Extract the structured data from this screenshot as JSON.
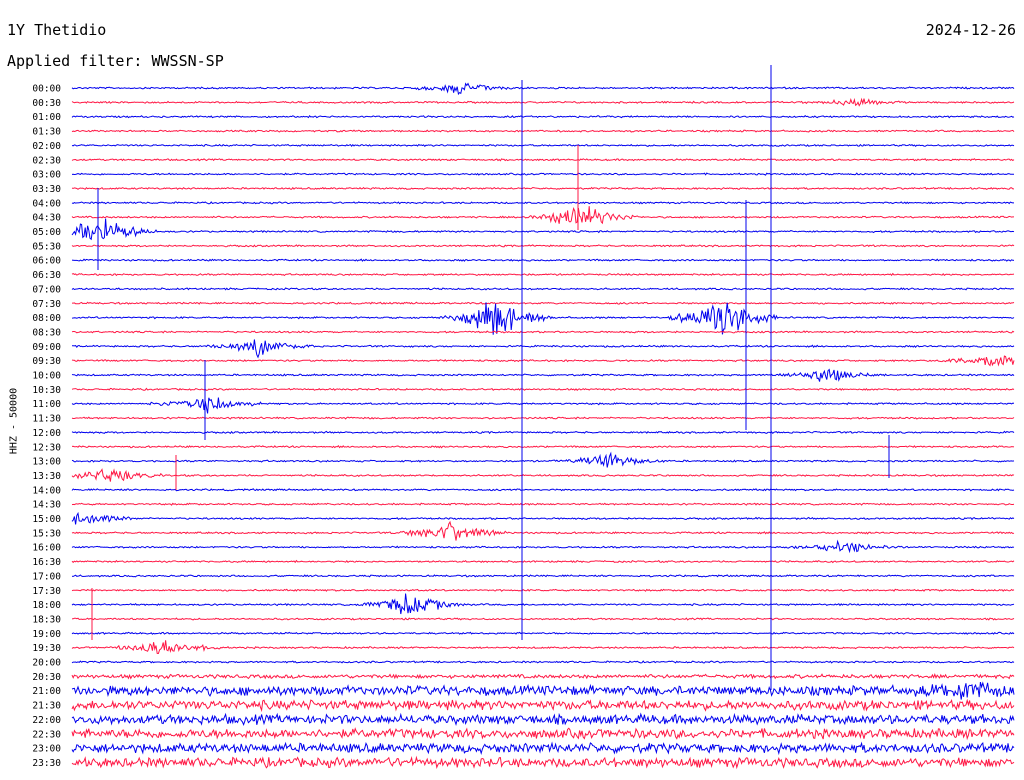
{
  "header": {
    "station": "1Y Thetidio",
    "date": "2024-12-26",
    "filter": "Applied filter: WWSSN-SP"
  },
  "chart_data": {
    "type": "line",
    "title": "1Y Thetidio",
    "subtitle": "Applied filter: WWSSN-SP",
    "ylabel": "HHZ - 50000",
    "xlabel": "",
    "row_labels": [
      "00:00",
      "00:30",
      "01:00",
      "01:30",
      "02:00",
      "02:30",
      "03:00",
      "03:30",
      "04:00",
      "04:30",
      "05:00",
      "05:30",
      "06:00",
      "06:30",
      "07:00",
      "07:30",
      "08:00",
      "08:30",
      "09:00",
      "09:30",
      "10:00",
      "10:30",
      "11:00",
      "11:30",
      "12:00",
      "12:30",
      "13:00",
      "13:30",
      "14:00",
      "14:30",
      "15:00",
      "15:30",
      "16:00",
      "16:30",
      "17:00",
      "17:30",
      "18:00",
      "18:30",
      "19:00",
      "19:30",
      "20:00",
      "20:30",
      "21:00",
      "21:30",
      "22:00",
      "22:30",
      "23:00",
      "23:30"
    ],
    "row_minutes": 30,
    "series_colors": [
      "#0000ee",
      "#ff1744"
    ],
    "events": [
      {
        "row": "00:00",
        "position": 0.41,
        "amplitude": 8
      },
      {
        "row": "00:30",
        "position": 0.83,
        "amplitude": 5
      },
      {
        "row": "04:30",
        "position": 0.54,
        "amplitude": 18
      },
      {
        "row": "05:00",
        "position": 0.03,
        "amplitude": 22
      },
      {
        "row": "08:00",
        "position": 0.45,
        "amplitude": 30
      },
      {
        "row": "08:00",
        "position": 0.69,
        "amplitude": 30
      },
      {
        "row": "09:00",
        "position": 0.2,
        "amplitude": 12
      },
      {
        "row": "09:30",
        "position": 0.98,
        "amplitude": 14
      },
      {
        "row": "10:00",
        "position": 0.8,
        "amplitude": 10
      },
      {
        "row": "11:00",
        "position": 0.14,
        "amplitude": 14
      },
      {
        "row": "13:00",
        "position": 0.57,
        "amplitude": 10
      },
      {
        "row": "13:30",
        "position": 0.04,
        "amplitude": 10
      },
      {
        "row": "15:00",
        "position": 0.01,
        "amplitude": 10
      },
      {
        "row": "15:30",
        "position": 0.4,
        "amplitude": 14
      },
      {
        "row": "16:00",
        "position": 0.82,
        "amplitude": 8
      },
      {
        "row": "18:00",
        "position": 0.36,
        "amplitude": 16
      },
      {
        "row": "19:30",
        "position": 0.1,
        "amplitude": 12
      },
      {
        "row": "21:00",
        "position": 0.95,
        "amplitude": 14
      }
    ]
  }
}
